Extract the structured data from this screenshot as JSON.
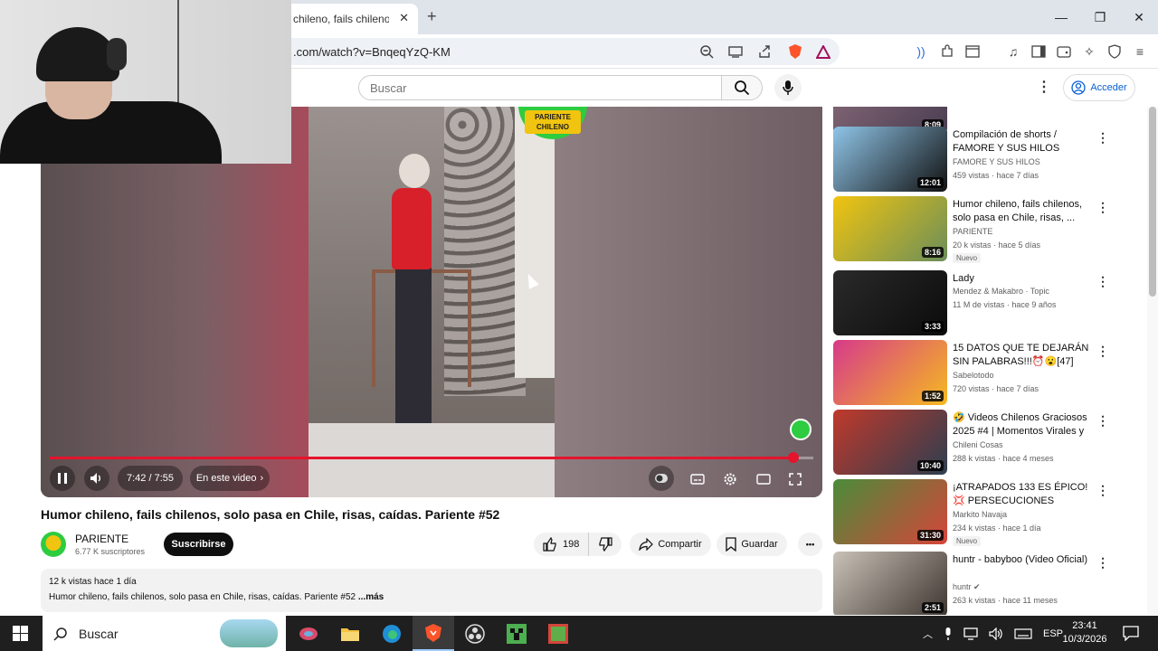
{
  "browser": {
    "tab_title": "chileno, fails chilenos,",
    "tab_close": "✕",
    "new_tab": "+",
    "address": ".com/watch?v=BnqeqYzQ-KM",
    "window_controls": {
      "minimize": "—",
      "maximize": "❐",
      "close": "✕"
    }
  },
  "header": {
    "search_placeholder": "Buscar",
    "login_label": "Acceder",
    "menu_glyph": "⋮"
  },
  "player": {
    "channel_badge": "PARIENTE CHILENO",
    "time": "7:42 / 7:55",
    "in_video_label": "En este video",
    "progress_fraction": 0.974
  },
  "video": {
    "title": "Humor chileno, fails chilenos, solo pasa en Chile, risas, caídas. Pariente #52",
    "channel": "PARIENTE",
    "subscribers": "6.77 K suscriptores",
    "subscribe_label": "Suscribirse",
    "likes": "198",
    "share_label": "Compartir",
    "save_label": "Guardar",
    "more_glyph": "•••",
    "views_date": "12 k vistas  hace 1 día",
    "description": "Humor chileno, fails chilenos, solo pasa en Chile, risas, caídas. Pariente #52",
    "more_label": "...más"
  },
  "recommendations": [
    {
      "title": "",
      "channel": "",
      "stats": "",
      "duration": "8:09",
      "badge": "",
      "colors": [
        "#8a6d7a",
        "#4a3d52"
      ]
    },
    {
      "title": "Compilación de shorts / FAMORE Y SUS HILOS",
      "channel": "FAMORE Y SUS HILOS",
      "stats": "459 vistas · hace 7 días",
      "duration": "12:01",
      "badge": "",
      "colors": [
        "#8fc5e8",
        "#111111"
      ]
    },
    {
      "title": "Humor chileno, fails chilenos, solo pasa en Chile, risas, ...",
      "channel": "PARIENTE",
      "stats": "20 k vistas · hace 5 días",
      "duration": "8:16",
      "badge": "Nuevo",
      "colors": [
        "#f1c40f",
        "#6b8e5a"
      ]
    },
    {
      "title": "Lady",
      "channel": "Mendez & Makabro · Topic",
      "stats": "11 M de vistas · hace 9 años",
      "duration": "3:33",
      "badge": "",
      "colors": [
        "#2a2a2a",
        "#0b0b0b"
      ]
    },
    {
      "title": "15 DATOS QUE TE DEJARÁN SIN PALABRAS!!!⏰😮[47]",
      "channel": "Sabelotodo",
      "stats": "720 vistas · hace 7 días",
      "duration": "1:52",
      "badge": "",
      "colors": [
        "#d63a8a",
        "#f5b921"
      ]
    },
    {
      "title": "🤣 Videos Chilenos Graciosos 2025 #4 | Momentos Virales y ...",
      "channel": "Chileni Cosas",
      "stats": "288 k vistas · hace 4 meses",
      "duration": "10:40",
      "badge": "",
      "colors": [
        "#c0392b",
        "#2c3e50"
      ]
    },
    {
      "title": "¡ATRAPADOS 133 ES ÉPICO! 💢 PERSECUCIONES CHILENAS ...",
      "channel": "Markito Navaja",
      "stats": "234 k vistas · hace 1 día",
      "duration": "31:30",
      "badge": "Nuevo",
      "colors": [
        "#4a8c3a",
        "#d6453a"
      ]
    },
    {
      "title": "huntr - babyboo (Video Oficial)",
      "channel": "huntr ✔",
      "stats": "263 k vistas · hace 11 meses",
      "duration": "2:51",
      "badge": "",
      "colors": [
        "#c9c2b8",
        "#3d352f"
      ]
    }
  ],
  "taskbar": {
    "search_label": "Buscar",
    "language": "ESP",
    "time": "23:41",
    "date": "10/3/2026"
  }
}
